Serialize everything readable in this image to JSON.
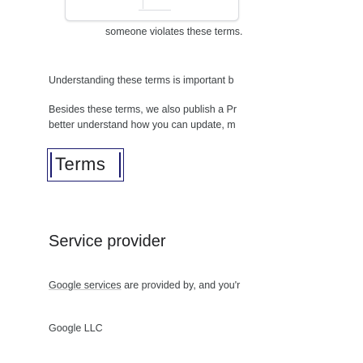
{
  "intro_fragment": "someone violates these terms.",
  "understanding_text": "Understanding these terms is important b",
  "besides": {
    "line1": "Besides these terms, we also publish a Pr",
    "line2": "better understand how you can update, m"
  },
  "terms_heading": "Terms",
  "service_provider": {
    "heading": "Service provider",
    "link_text": "Google services",
    "rest_text": " are provided by, and you'r",
    "company": "Google LLC"
  }
}
